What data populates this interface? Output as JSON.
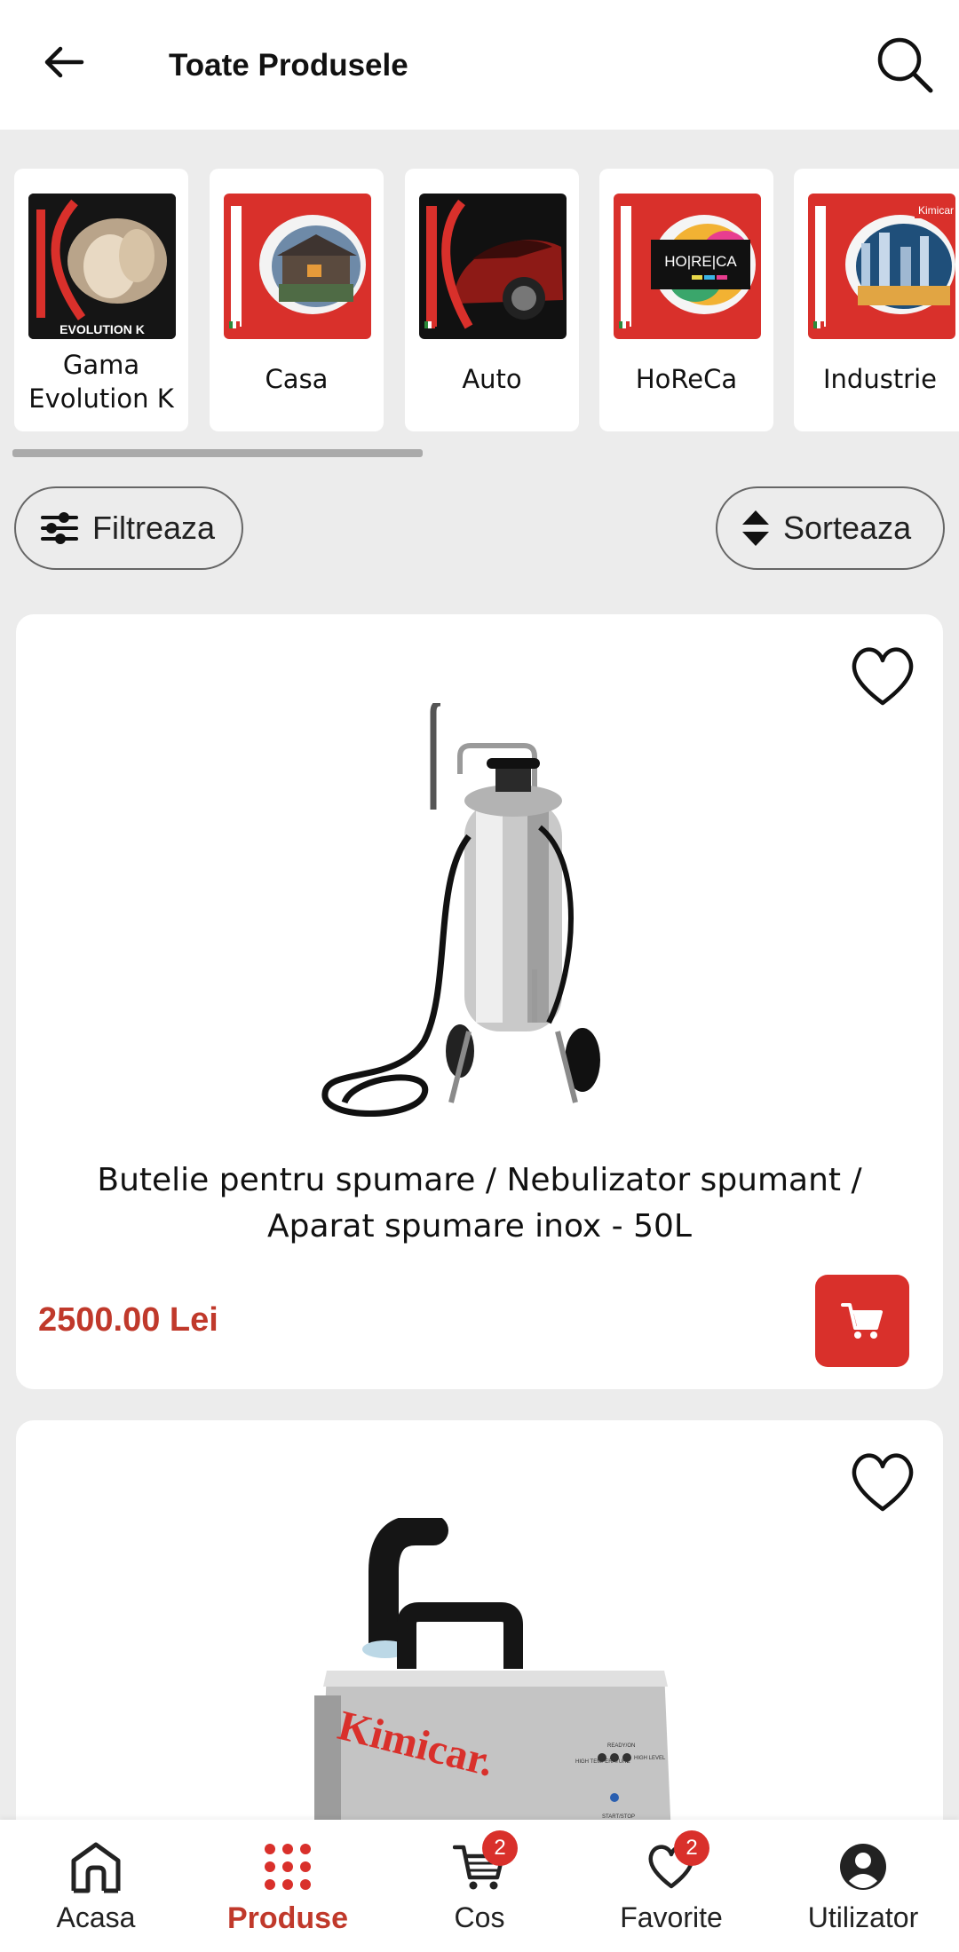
{
  "header": {
    "title": "Toate Produsele"
  },
  "categories": [
    {
      "label": "Gama Evolution K",
      "thumb_caption": "EVOLUTION K"
    },
    {
      "label": "Casa"
    },
    {
      "label": "Auto"
    },
    {
      "label": "HoReCa",
      "thumb_caption": "HO|RE|CA"
    },
    {
      "label": "Industrie",
      "thumb_caption": "Kimicar"
    }
  ],
  "controls": {
    "filter_label": "Filtreaza",
    "sort_label": "Sorteaza"
  },
  "products": [
    {
      "name": "Butelie pentru spumare / Nebulizator spumant / Aparat spumare inox - 50L",
      "price": "2500.00 Lei"
    },
    {
      "brand_text": "Kimicar.",
      "panel_labels": [
        "HIGH TEMPERATURE",
        "READY/ON",
        "HIGH LEVEL",
        "START/STOP"
      ]
    }
  ],
  "nav": {
    "items": [
      {
        "label": "Acasa"
      },
      {
        "label": "Produse"
      },
      {
        "label": "Cos",
        "badge": "2"
      },
      {
        "label": "Favorite",
        "badge": "2"
      },
      {
        "label": "Utilizator"
      }
    ],
    "active": "Produse"
  },
  "colors": {
    "accent": "#d9302b",
    "price": "#c0392b",
    "background": "#ececec"
  }
}
